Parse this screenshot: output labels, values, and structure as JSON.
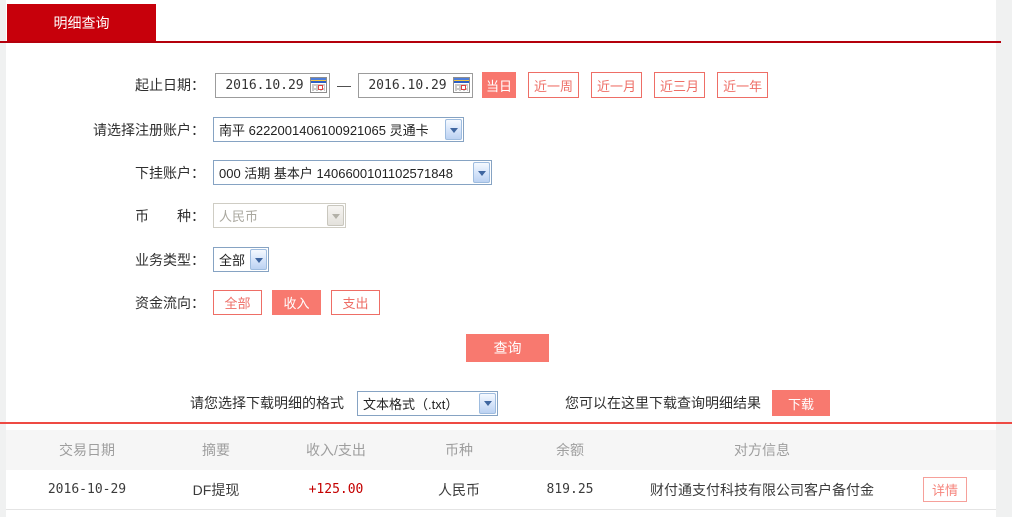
{
  "colors": {
    "brand_red": "#c7000b",
    "top_line_red": "#b4000c",
    "separator_red": "#ee4a43",
    "button_salmon": "#f8796f",
    "outline_red": "#ee6e66",
    "amount_red": "#c40000"
  },
  "tab": {
    "label": "明细查询"
  },
  "form": {
    "date": {
      "label": "起止日期：",
      "start": "2016.10.29",
      "separator": "—",
      "end": "2016.10.29"
    },
    "quick_ranges": [
      {
        "label": "当日",
        "active": true
      },
      {
        "label": "近一周",
        "active": false
      },
      {
        "label": "近一月",
        "active": false
      },
      {
        "label": "近三月",
        "active": false
      },
      {
        "label": "近一年",
        "active": false
      }
    ],
    "register_account": {
      "label": "请选择注册账户：",
      "value": "南平 6222001406100921065 灵通卡"
    },
    "sub_account": {
      "label": "下挂账户：",
      "value": "000 活期 基本户 1406600101102571848"
    },
    "currency": {
      "label": "币　　种：",
      "value": "人民币",
      "disabled": true
    },
    "business_type": {
      "label": "业务类型：",
      "value": "全部"
    },
    "fund_flow": {
      "label": "资金流向：",
      "options": [
        {
          "label": "全部",
          "active": false
        },
        {
          "label": "收入",
          "active": true
        },
        {
          "label": "支出",
          "active": false
        }
      ]
    },
    "query_button_label": "查询"
  },
  "download": {
    "format_label": "请您选择下载明细的格式",
    "format_value": "文本格式（.txt）",
    "hint": "您可以在这里下载查询明细结果",
    "button_label": "下载"
  },
  "table": {
    "headers": [
      "交易日期",
      "摘要",
      "收入/支出",
      "币种",
      "余额",
      "对方信息"
    ],
    "rows": [
      {
        "date": "2016-10-29",
        "summary": "DF提现",
        "amount": "+125.00",
        "currency": "人民币",
        "balance": "819.25",
        "counterparty": "财付通支付科技有限公司客户备付金",
        "action_label": "详情"
      }
    ]
  }
}
